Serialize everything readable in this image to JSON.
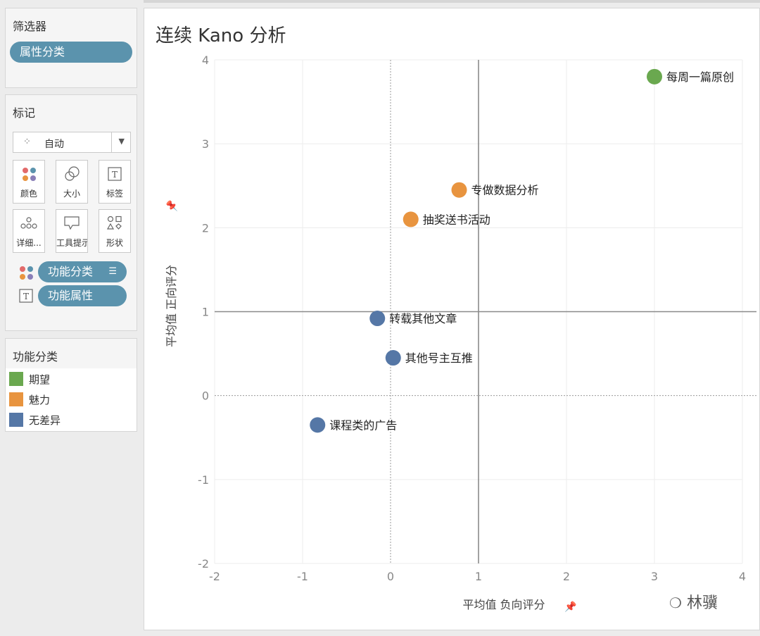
{
  "filters": {
    "title": "筛选器",
    "pill": "属性分类"
  },
  "marks": {
    "title": "标记",
    "dropdown_value": "自动",
    "buttons": [
      {
        "label": "颜色",
        "icon": "color-icon"
      },
      {
        "label": "大小",
        "icon": "size-icon"
      },
      {
        "label": "标签",
        "icon": "label-icon"
      },
      {
        "label": "详细...",
        "icon": "detail-icon"
      },
      {
        "label": "工具提示",
        "icon": "tooltip-icon"
      },
      {
        "label": "形状",
        "icon": "shape-icon"
      }
    ],
    "fields": [
      {
        "label": "功能分类",
        "icon": "color-icon"
      },
      {
        "label": "功能属性",
        "icon": "label-icon"
      }
    ]
  },
  "legend": {
    "title": "功能分类",
    "items": [
      {
        "label": "期望",
        "color": "#6aa84f"
      },
      {
        "label": "魅力",
        "color": "#e8943f"
      },
      {
        "label": "无差异",
        "color": "#5577a6"
      }
    ]
  },
  "chart_data": {
    "type": "scatter",
    "title": "连续 Kano 分析",
    "xlabel": "平均值 负向评分",
    "ylabel": "平均值 正向评分",
    "xlim": [
      -2,
      4
    ],
    "ylim": [
      -2,
      4
    ],
    "xticks": [
      "-2",
      "-1",
      "0",
      "1",
      "2",
      "3",
      "4"
    ],
    "yticks": [
      "4",
      "3",
      "2",
      "1",
      "0",
      "-1",
      "-2"
    ],
    "reference_lines": {
      "x": 1,
      "y": 1
    },
    "grid": true,
    "points": [
      {
        "label": "每周一篇原创",
        "x": 3.0,
        "y": 3.8,
        "category": "期望",
        "color": "#6aa84f"
      },
      {
        "label": "专做数据分析",
        "x": 0.78,
        "y": 2.45,
        "category": "魅力",
        "color": "#e8943f"
      },
      {
        "label": "抽奖送书活动",
        "x": 0.23,
        "y": 2.1,
        "category": "魅力",
        "color": "#e8943f"
      },
      {
        "label": "转载其他文章",
        "x": -0.15,
        "y": 0.92,
        "category": "无差异",
        "color": "#5577a6"
      },
      {
        "label": "其他号主互推",
        "x": 0.03,
        "y": 0.45,
        "category": "无差异",
        "color": "#5577a6"
      },
      {
        "label": "课程类的广告",
        "x": -0.83,
        "y": -0.35,
        "category": "无差异",
        "color": "#5577a6"
      }
    ]
  },
  "watermark": "林骥"
}
